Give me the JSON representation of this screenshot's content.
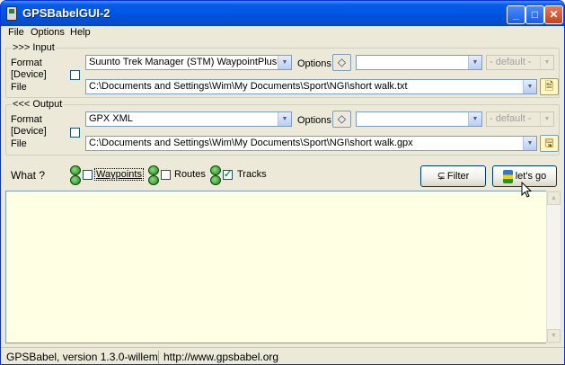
{
  "window": {
    "title": "GPSBabelGUI-2"
  },
  "menu": [
    "File",
    "Options",
    "Help"
  ],
  "input": {
    "group_title": ">>> Input",
    "format_label": "Format",
    "device_label": "[Device]",
    "file_label": "File",
    "format_value": "Suunto Trek Manager (STM) WaypointPlus files",
    "options_label": "Options",
    "options_value": "",
    "default_value": "- default -",
    "file_value": "C:\\Documents and Settings\\Wim\\My Documents\\Sport\\NGI\\short walk.txt"
  },
  "output": {
    "group_title": "<<< Output",
    "format_label": "Format",
    "device_label": "[Device]",
    "file_label": "File",
    "format_value": "GPX XML",
    "options_label": "Options",
    "options_value": "",
    "default_value": "- default -",
    "file_value": "C:\\Documents and Settings\\Wim\\My Documents\\Sport\\NGI\\short walk.gpx"
  },
  "what": {
    "label": "What ?",
    "items": [
      {
        "label": "Waypoints",
        "checked": false
      },
      {
        "label": "Routes",
        "checked": false
      },
      {
        "label": "Tracks",
        "checked": true
      }
    ],
    "filter_label": "Filter",
    "go_label": "let's go"
  },
  "statusbar": {
    "version": "GPSBabel, version 1.3.0-willem",
    "url": "http://www.gpsbabel.org"
  }
}
